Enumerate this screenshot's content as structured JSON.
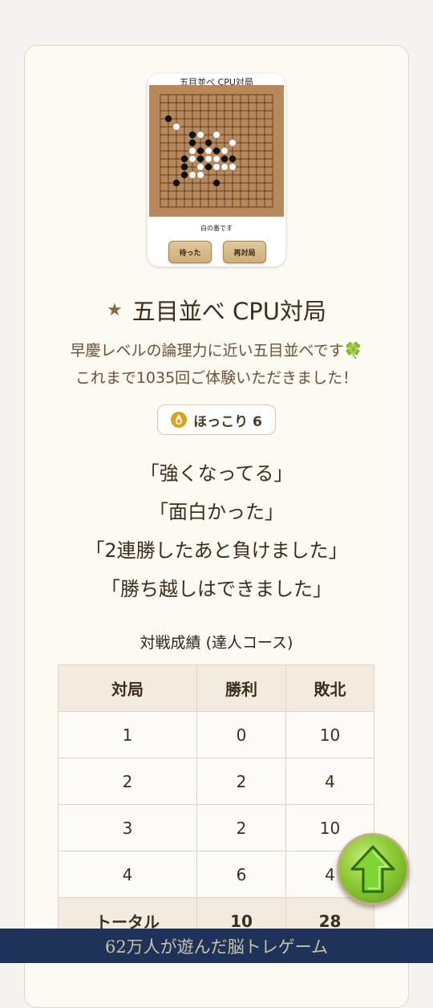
{
  "game_preview": {
    "title": "五目並べ CPU対局",
    "status": "白の番です",
    "wait_label": "待った",
    "replay_label": "再対局",
    "board": {
      "size": 15,
      "black_stones": [
        [
          1,
          3
        ],
        [
          4,
          5
        ],
        [
          6,
          6
        ],
        [
          4,
          6
        ],
        [
          5,
          7
        ],
        [
          7,
          7
        ],
        [
          3,
          8
        ],
        [
          5,
          8
        ],
        [
          8,
          8
        ],
        [
          6,
          9
        ],
        [
          9,
          8
        ],
        [
          3,
          10
        ],
        [
          2,
          11
        ],
        [
          7,
          11
        ],
        [
          3,
          9
        ]
      ],
      "white_stones": [
        [
          2,
          4
        ],
        [
          5,
          5
        ],
        [
          7,
          5
        ],
        [
          4,
          7
        ],
        [
          6,
          7
        ],
        [
          8,
          7
        ],
        [
          9,
          6
        ],
        [
          4,
          8
        ],
        [
          6,
          8
        ],
        [
          7,
          8
        ],
        [
          5,
          9
        ],
        [
          7,
          9
        ],
        [
          8,
          9
        ],
        [
          5,
          10
        ],
        [
          9,
          9
        ],
        [
          4,
          10
        ]
      ],
      "board_color": "#b8885a",
      "line_color": "#3b2614"
    }
  },
  "header": {
    "star_icon": "star-icon",
    "title": "五目並べ CPU対局"
  },
  "description": {
    "line1": "早慶レベルの論理力に近い五目並べです🍀",
    "line2": "これまで1035回ご体験いただきました！"
  },
  "badge": {
    "icon": "drop-icon",
    "label": "ほっこり 6"
  },
  "quotes": [
    "「強くなってる」",
    "「面白かった」",
    "「2連勝したあと負けました」",
    "「勝ち越しはできました」"
  ],
  "stats": {
    "heading": "対戦成績 (達人コース)",
    "columns": [
      "対局",
      "勝利",
      "敗北"
    ],
    "rows": [
      [
        "1",
        "0",
        "10"
      ],
      [
        "2",
        "2",
        "4"
      ],
      [
        "3",
        "2",
        "10"
      ],
      [
        "4",
        "6",
        "4"
      ]
    ],
    "total": [
      "トータル",
      "10",
      "28"
    ]
  },
  "scroll_top_icon": "up-arrow-icon",
  "footer": {
    "text": "62万人が遊んだ脳トレゲーム"
  },
  "colors": {
    "accent": "#8a6a44",
    "footer_bg": "#1e3358",
    "card_bg": "#fdf9f3"
  }
}
